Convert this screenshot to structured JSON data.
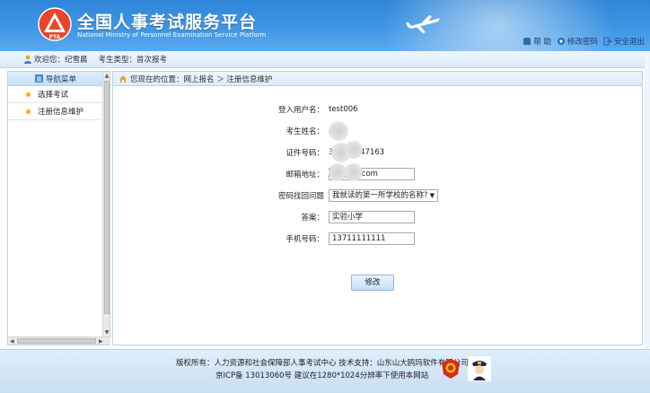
{
  "header": {
    "title_cn": "全国人事考试服务平台",
    "title_en": "National Ministry of Personnel Examination Service Platform",
    "logo_text": "PTA",
    "links": [
      {
        "label": "帮 助",
        "icon": "help-icon"
      },
      {
        "label": "修改密码",
        "icon": "settings-icon"
      },
      {
        "label": "安全退出",
        "icon": "logout-icon"
      }
    ]
  },
  "userbar": {
    "welcome": "欢迎您：纪雪晨",
    "type": "考生类型：首次报考"
  },
  "sidebar": {
    "title": "导航菜单",
    "items": [
      {
        "label": "选择考试"
      },
      {
        "label": "注册信息维护"
      }
    ]
  },
  "breadcrumb": {
    "text": "您现在的位置：网上报名 ＞ 注册信息维护"
  },
  "form": {
    "fields": [
      {
        "label": "登入用户名：",
        "value": "test006"
      },
      {
        "label": "考生姓名：",
        "value": "纪"
      },
      {
        "label": "证件号码：",
        "value": "3              3707147163"
      },
      {
        "label": "邮箱地址：",
        "value": "             39@qq.com"
      },
      {
        "label": "密码找回问题",
        "value": "我就读的第一所学校的名称?"
      },
      {
        "label": "答案：",
        "value": "实验小学"
      },
      {
        "label": "手机号码：",
        "value": "13711111111"
      }
    ],
    "submit_label": "修改"
  },
  "footer": {
    "line1": "版权所有：人力资源和社会保障部人事考试中心  技术支持：山东山大鸥玛软件有限公司",
    "line2": "京ICP备 13013060号  建议在1280*1024分辨率下使用本网站"
  },
  "colors": {
    "header_blue": "#3f96e4",
    "panel_border": "#b9d3ea",
    "bullet": "#f2b200"
  }
}
